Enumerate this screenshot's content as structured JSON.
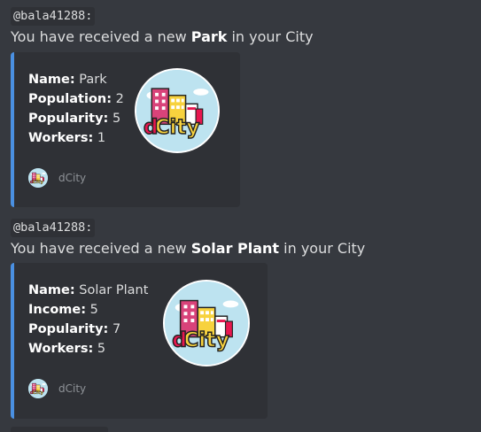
{
  "messages": [
    {
      "author": "@bala41288:",
      "text_prefix": "You have received a new ",
      "item": "Park",
      "text_suffix": " in your City",
      "embed": {
        "fields": [
          {
            "label": "Name:",
            "value": " Park"
          },
          {
            "label": "Population:",
            "value": " 2"
          },
          {
            "label": "Popularity:",
            "value": " 5"
          },
          {
            "label": "Workers:",
            "value": " 1"
          }
        ],
        "thumbnail_icon": "dcity-logo-icon",
        "footer": "dCity"
      }
    },
    {
      "author": "@bala41288:",
      "text_prefix": "You have received a new ",
      "item": "Solar Plant",
      "text_suffix": " in your City",
      "embed": {
        "fields": [
          {
            "label": "Name:",
            "value": " Solar Plant"
          },
          {
            "label": "Income:",
            "value": " 5"
          },
          {
            "label": "Popularity:",
            "value": " 7"
          },
          {
            "label": "Workers:",
            "value": " 5"
          }
        ],
        "thumbnail_icon": "dcity-logo-icon",
        "footer": "dCity"
      }
    }
  ],
  "colors": {
    "background": "#36393f",
    "embed_background": "#2f3136",
    "embed_accent": "#4a90e2",
    "logo_red": "#e8174f",
    "logo_yellow": "#f7d23e",
    "logo_pink": "#d9437a"
  }
}
